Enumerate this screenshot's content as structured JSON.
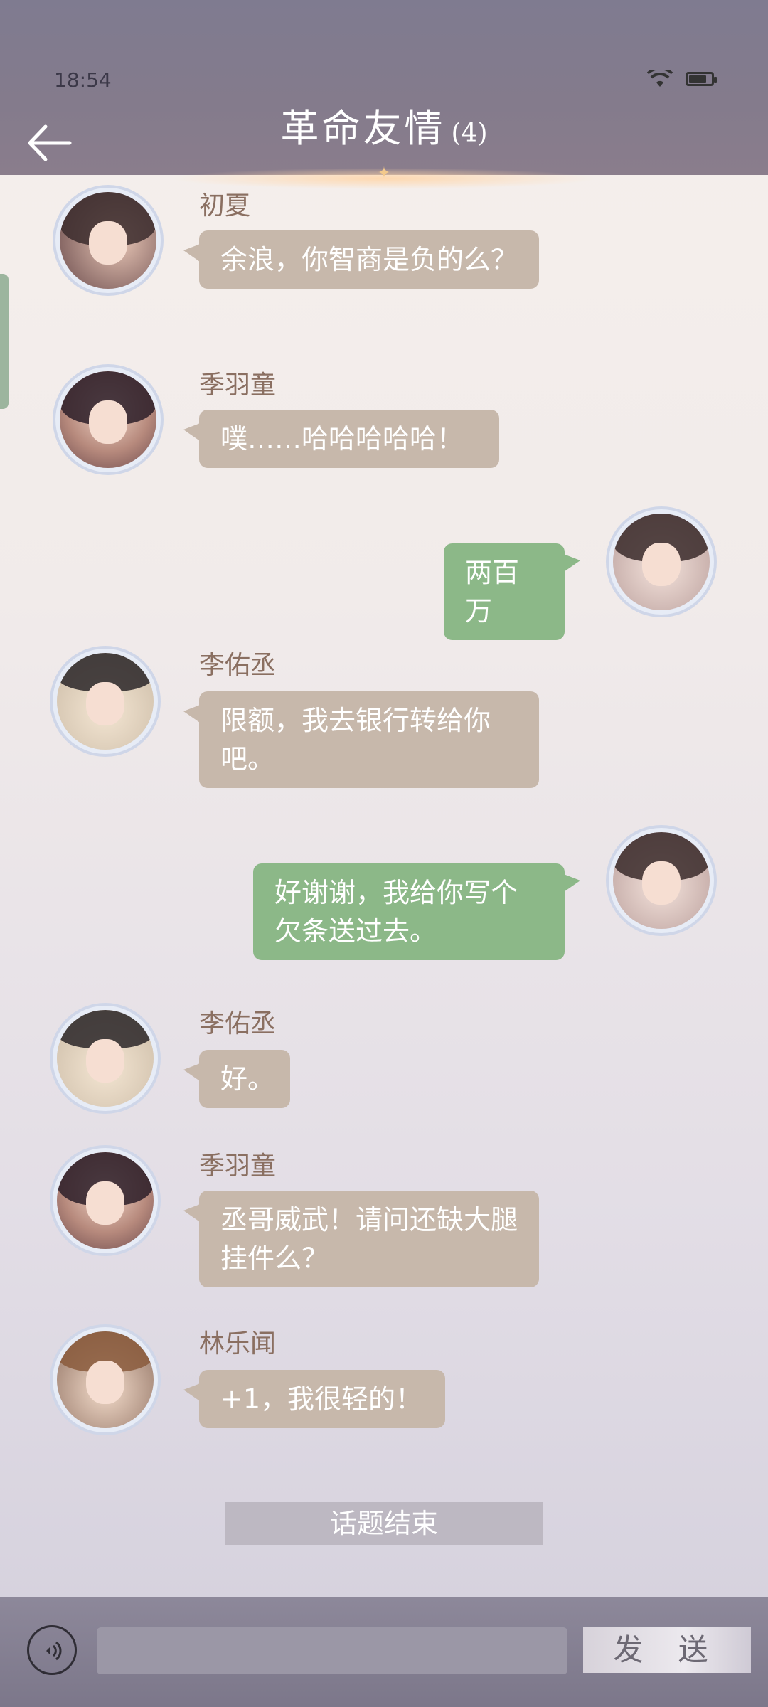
{
  "status_bar": {
    "time": "18:54"
  },
  "header": {
    "title": "革命友情",
    "member_count": "(4)"
  },
  "messages": [
    {
      "sender": "初夏",
      "text": "余浪，你智商是负的么？",
      "side": "left"
    },
    {
      "sender": "季羽童",
      "text": "噗……哈哈哈哈哈！",
      "side": "left"
    },
    {
      "sender": "",
      "text": "两百万",
      "side": "right"
    },
    {
      "sender": "李佑丞",
      "text": "限额，我去银行转给你吧。",
      "side": "left"
    },
    {
      "sender": "",
      "text": "好谢谢，我给你写个欠条送过去。",
      "side": "right"
    },
    {
      "sender": "李佑丞",
      "text": "好。",
      "side": "left"
    },
    {
      "sender": "季羽童",
      "text": "丞哥威武！请问还缺大腿挂件么？",
      "side": "left"
    },
    {
      "sender": "林乐闻",
      "text": "+1，我很轻的！",
      "side": "left"
    }
  ],
  "end_topic": "话题结束",
  "footer": {
    "send_label": "发 送",
    "input_value": ""
  },
  "colors": {
    "header": "#847b8c",
    "left_bubble": "#c7b8ab",
    "right_bubble": "#8cb888",
    "name": "#8a6f61"
  },
  "icons": {
    "back": "arrow-left-icon",
    "wifi": "wifi-icon",
    "battery": "battery-icon",
    "voice": "voice-icon"
  }
}
